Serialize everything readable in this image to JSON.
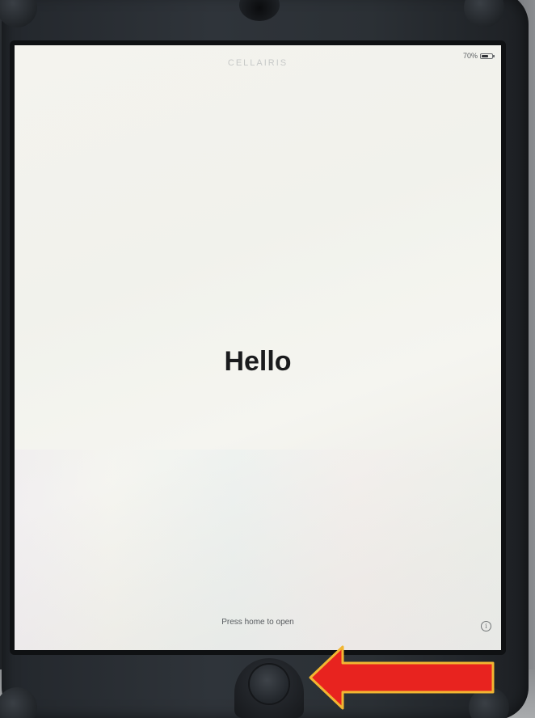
{
  "device": {
    "carrier_label": "CELLAIRIS",
    "battery": {
      "label": "70%",
      "level": 0.7
    }
  },
  "screen": {
    "greeting": "Hello",
    "instruction": "Press home to open",
    "info_icon": "info-icon"
  },
  "annotation": {
    "arrow_color": "#e8231f",
    "arrow_outline": "#f2b632",
    "target": "home-button"
  }
}
